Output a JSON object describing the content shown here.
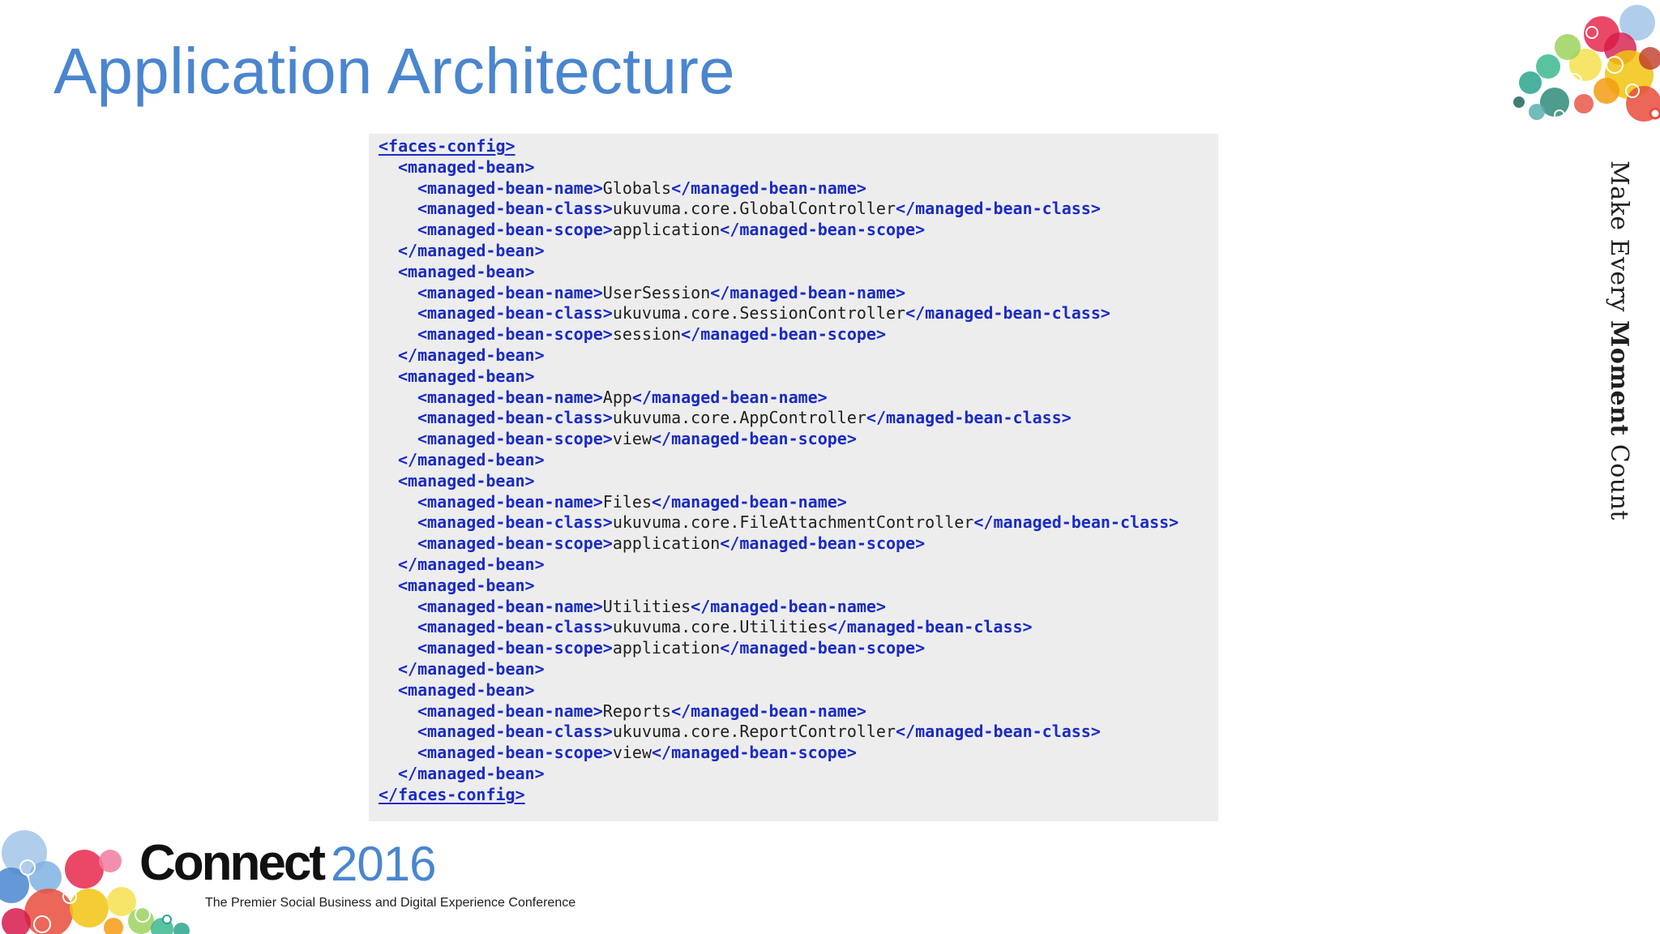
{
  "slide": {
    "title": "Application Architecture"
  },
  "code": {
    "lines": [
      {
        "indent": 0,
        "parts": [
          {
            "t": "tag",
            "v": "<faces-config>"
          }
        ]
      },
      {
        "indent": 1,
        "parts": [
          {
            "t": "tag",
            "v": "<managed-bean>"
          }
        ]
      },
      {
        "indent": 2,
        "parts": [
          {
            "t": "tag",
            "v": "<managed-bean-name>"
          },
          {
            "t": "text",
            "v": "Globals"
          },
          {
            "t": "tag",
            "v": "</managed-bean-name>"
          }
        ]
      },
      {
        "indent": 2,
        "parts": [
          {
            "t": "tag",
            "v": "<managed-bean-class>"
          },
          {
            "t": "text",
            "v": "ukuvuma.core.GlobalController"
          },
          {
            "t": "tag",
            "v": "</managed-bean-class>"
          }
        ]
      },
      {
        "indent": 2,
        "parts": [
          {
            "t": "tag",
            "v": "<managed-bean-scope>"
          },
          {
            "t": "text",
            "v": "application"
          },
          {
            "t": "tag",
            "v": "</managed-bean-scope>"
          }
        ]
      },
      {
        "indent": 1,
        "parts": [
          {
            "t": "tag",
            "v": "</managed-bean>"
          }
        ]
      },
      {
        "indent": 1,
        "parts": [
          {
            "t": "tag",
            "v": "<managed-bean>"
          }
        ]
      },
      {
        "indent": 2,
        "parts": [
          {
            "t": "tag",
            "v": "<managed-bean-name>"
          },
          {
            "t": "text",
            "v": "UserSession"
          },
          {
            "t": "tag",
            "v": "</managed-bean-name>"
          }
        ]
      },
      {
        "indent": 2,
        "parts": [
          {
            "t": "tag",
            "v": "<managed-bean-class>"
          },
          {
            "t": "text",
            "v": "ukuvuma.core.SessionController"
          },
          {
            "t": "tag",
            "v": "</managed-bean-class>"
          }
        ]
      },
      {
        "indent": 2,
        "parts": [
          {
            "t": "tag",
            "v": "<managed-bean-scope>"
          },
          {
            "t": "text",
            "v": "session"
          },
          {
            "t": "tag",
            "v": "</managed-bean-scope>"
          }
        ]
      },
      {
        "indent": 1,
        "parts": [
          {
            "t": "tag",
            "v": "</managed-bean>"
          }
        ]
      },
      {
        "indent": 1,
        "parts": [
          {
            "t": "tag",
            "v": "<managed-bean>"
          }
        ]
      },
      {
        "indent": 2,
        "parts": [
          {
            "t": "tag",
            "v": "<managed-bean-name>"
          },
          {
            "t": "text",
            "v": "App"
          },
          {
            "t": "tag",
            "v": "</managed-bean-name>"
          }
        ]
      },
      {
        "indent": 2,
        "parts": [
          {
            "t": "tag",
            "v": "<managed-bean-class>"
          },
          {
            "t": "text",
            "v": "ukuvuma.core.AppController"
          },
          {
            "t": "tag",
            "v": "</managed-bean-class>"
          }
        ]
      },
      {
        "indent": 2,
        "parts": [
          {
            "t": "tag",
            "v": "<managed-bean-scope>"
          },
          {
            "t": "text",
            "v": "view"
          },
          {
            "t": "tag",
            "v": "</managed-bean-scope>"
          }
        ]
      },
      {
        "indent": 1,
        "parts": [
          {
            "t": "tag",
            "v": "</managed-bean>"
          }
        ]
      },
      {
        "indent": 1,
        "parts": [
          {
            "t": "tag",
            "v": "<managed-bean>"
          }
        ]
      },
      {
        "indent": 2,
        "parts": [
          {
            "t": "tag",
            "v": "<managed-bean-name>"
          },
          {
            "t": "text",
            "v": "Files"
          },
          {
            "t": "tag",
            "v": "</managed-bean-name>"
          }
        ]
      },
      {
        "indent": 2,
        "parts": [
          {
            "t": "tag",
            "v": "<managed-bean-class>"
          },
          {
            "t": "text",
            "v": "ukuvuma.core.FileAttachmentController"
          },
          {
            "t": "tag",
            "v": "</managed-bean-class>"
          }
        ]
      },
      {
        "indent": 2,
        "parts": [
          {
            "t": "tag",
            "v": "<managed-bean-scope>"
          },
          {
            "t": "text",
            "v": "application"
          },
          {
            "t": "tag",
            "v": "</managed-bean-scope>"
          }
        ]
      },
      {
        "indent": 1,
        "parts": [
          {
            "t": "tag",
            "v": "</managed-bean>"
          }
        ]
      },
      {
        "indent": 1,
        "parts": [
          {
            "t": "tag",
            "v": "<managed-bean>"
          }
        ]
      },
      {
        "indent": 2,
        "parts": [
          {
            "t": "tag",
            "v": "<managed-bean-name>"
          },
          {
            "t": "text",
            "v": "Utilities"
          },
          {
            "t": "tag",
            "v": "</managed-bean-name>"
          }
        ]
      },
      {
        "indent": 2,
        "parts": [
          {
            "t": "tag",
            "v": "<managed-bean-class>"
          },
          {
            "t": "text",
            "v": "ukuvuma.core.Utilities"
          },
          {
            "t": "tag",
            "v": "</managed-bean-class>"
          }
        ]
      },
      {
        "indent": 2,
        "parts": [
          {
            "t": "tag",
            "v": "<managed-bean-scope>"
          },
          {
            "t": "text",
            "v": "application"
          },
          {
            "t": "tag",
            "v": "</managed-bean-scope>"
          }
        ]
      },
      {
        "indent": 1,
        "parts": [
          {
            "t": "tag",
            "v": "</managed-bean>"
          }
        ]
      },
      {
        "indent": 1,
        "parts": [
          {
            "t": "tag",
            "v": "<managed-bean>"
          }
        ]
      },
      {
        "indent": 2,
        "parts": [
          {
            "t": "tag",
            "v": "<managed-bean-name>"
          },
          {
            "t": "text",
            "v": "Reports"
          },
          {
            "t": "tag",
            "v": "</managed-bean-name>"
          }
        ]
      },
      {
        "indent": 2,
        "parts": [
          {
            "t": "tag",
            "v": "<managed-bean-class>"
          },
          {
            "t": "text",
            "v": "ukuvuma.core.ReportController"
          },
          {
            "t": "tag",
            "v": "</managed-bean-class>"
          }
        ]
      },
      {
        "indent": 2,
        "parts": [
          {
            "t": "tag",
            "v": "<managed-bean-scope>"
          },
          {
            "t": "text",
            "v": "view"
          },
          {
            "t": "tag",
            "v": "</managed-bean-scope>"
          }
        ]
      },
      {
        "indent": 1,
        "parts": [
          {
            "t": "tag",
            "v": "</managed-bean>"
          }
        ]
      },
      {
        "indent": 0,
        "parts": [
          {
            "t": "tag",
            "v": "</faces-config>"
          }
        ]
      }
    ],
    "tag_color": "#1a2bc4",
    "text_color": "#1f1f1f",
    "panel_color": "#ededed"
  },
  "sidebar": {
    "tagline_pre": "Make Every ",
    "tagline_bold": "Moment",
    "tagline_post": " Count"
  },
  "branding": {
    "logo_word": "Connect",
    "logo_year": "2016",
    "subtitle": "The Premier Social Business and Digital Experience Conference",
    "title_color": "#4a86cf",
    "decoration": "colorful-bubbles"
  }
}
